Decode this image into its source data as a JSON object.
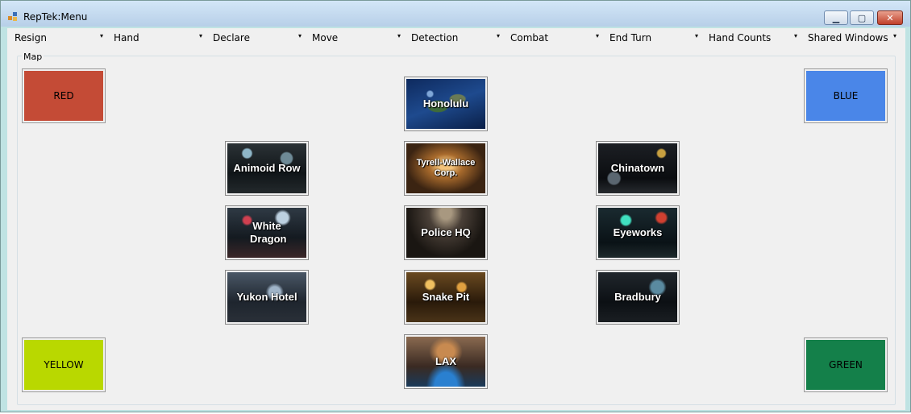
{
  "window": {
    "title": "RepTek:Menu",
    "minimize_glyph": "▁",
    "maximize_glyph": "▢",
    "close_glyph": "✕"
  },
  "menu": {
    "arrow": "▾",
    "items": [
      "Resign",
      "Hand",
      "Declare",
      "Move",
      "Detection",
      "Combat",
      "End Turn",
      "Hand Counts",
      "Shared Windows"
    ]
  },
  "map": {
    "label": "Map",
    "corners": {
      "red": {
        "label": "RED",
        "color": "#c44b36"
      },
      "blue": {
        "label": "BLUE",
        "color": "#4a86e8"
      },
      "yellow": {
        "label": "YELLOW",
        "color": "#b9d800"
      },
      "green": {
        "label": "GREEN",
        "color": "#14804a"
      }
    },
    "locations": {
      "honolulu": "Honolulu",
      "animoid_row": "Animoid Row",
      "tyrell_wallace": "Tyrell-Wallace Corp.",
      "chinatown": "Chinatown",
      "white_dragon": "White Dragon",
      "police_hq": "Police HQ",
      "eyeworks": "Eyeworks",
      "yukon_hotel": "Yukon Hotel",
      "snake_pit": "Snake Pit",
      "bradbury": "Bradbury",
      "lax": "LAX"
    }
  }
}
